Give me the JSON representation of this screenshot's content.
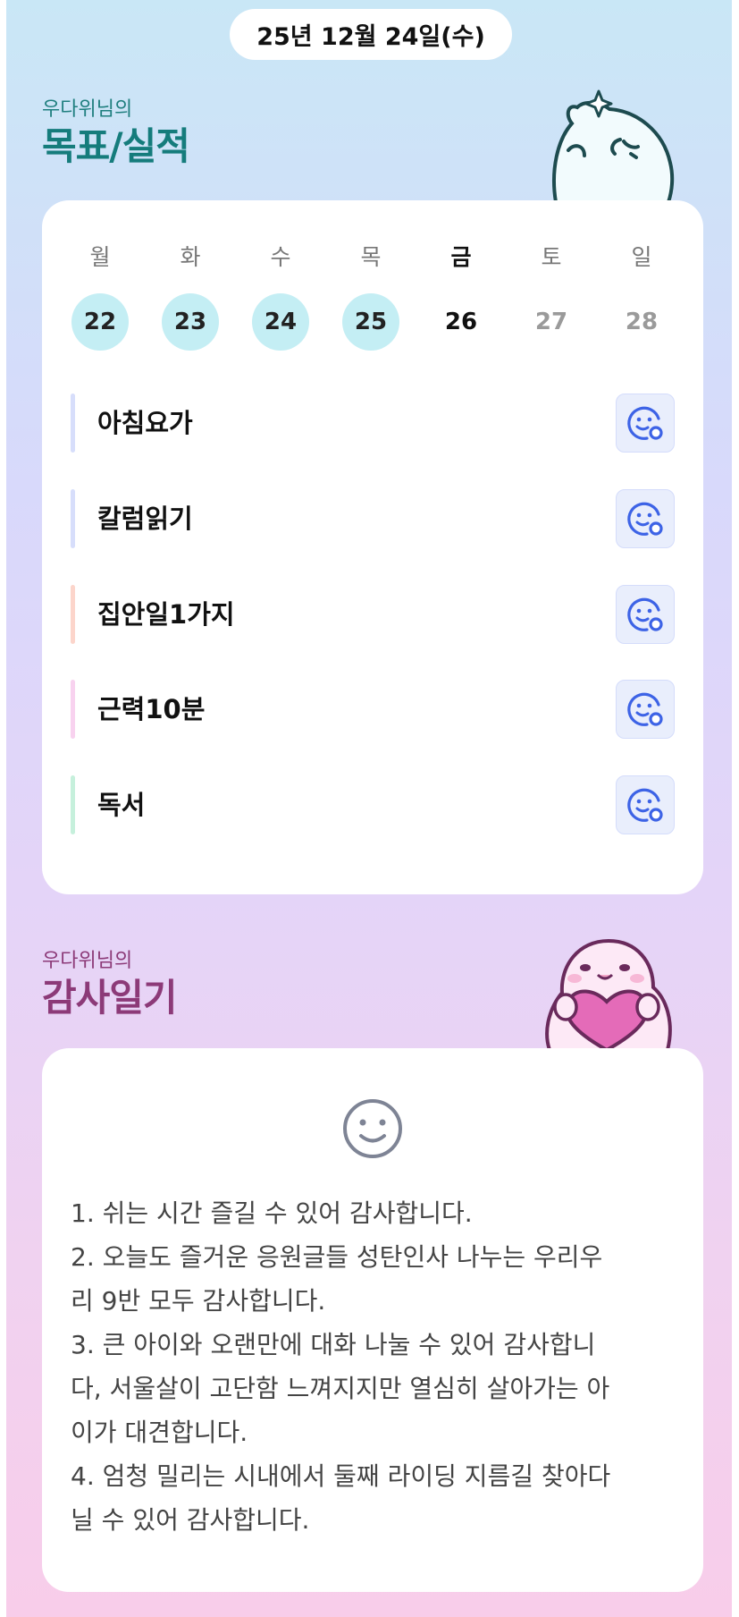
{
  "header": {
    "date": "25년 12월 24일(수)"
  },
  "goals_section": {
    "subtitle": "우다위님의",
    "title": "목표/실적",
    "mascot_icon": "ghost-mascot-sparkle",
    "title_color": "#157c7c",
    "subtitle_color": "#1f7f7f"
  },
  "week": {
    "days": [
      {
        "name": "월",
        "num": "22",
        "state": "done"
      },
      {
        "name": "화",
        "num": "23",
        "state": "done"
      },
      {
        "name": "수",
        "num": "24",
        "state": "done"
      },
      {
        "name": "목",
        "num": "25",
        "state": "done"
      },
      {
        "name": "금",
        "num": "26",
        "state": "today"
      },
      {
        "name": "토",
        "num": "27",
        "state": "future"
      },
      {
        "name": "일",
        "num": "28",
        "state": "future"
      }
    ],
    "done_color": "#c4eef4"
  },
  "goals": [
    {
      "label": "아침요가",
      "bar_color": "#d7defb",
      "icon": "smile-plus-icon"
    },
    {
      "label": "칼럼읽기",
      "bar_color": "#d7defb",
      "icon": "smile-plus-icon"
    },
    {
      "label": "집안일1가지",
      "bar_color": "#fcd5cb",
      "icon": "smile-plus-icon"
    },
    {
      "label": "근력10분",
      "bar_color": "#f8d2ef",
      "icon": "smile-plus-icon"
    },
    {
      "label": "독서",
      "bar_color": "#c6f0dc",
      "icon": "smile-plus-icon"
    }
  ],
  "gratitude_section": {
    "subtitle": "우다위님의",
    "title": "감사일기",
    "mascot_icon": "ghost-mascot-heart",
    "title_color": "#8c3a78",
    "subtitle_color": "#8c3a78"
  },
  "diary": {
    "icon": "smile-icon",
    "lines": [
      "1. 쉬는 시간 즐길 수 있어 감사합니다.",
      "2. 오늘도 즐거운 응원글들 성탄인사 나누는 우리우",
      "리 9반 모두 감사합니다.",
      "3. 큰 아이와 오랜만에 대화 나눌 수 있어 감사합니",
      "다, 서울살이 고단함 느껴지지만 열심히 살아가는 아",
      "이가 대견합니다.",
      "4. 엄청 밀리는 시내에서 둘째 라이딩 지름길 찾아다",
      "닐 수 있어 감사합니다."
    ]
  }
}
